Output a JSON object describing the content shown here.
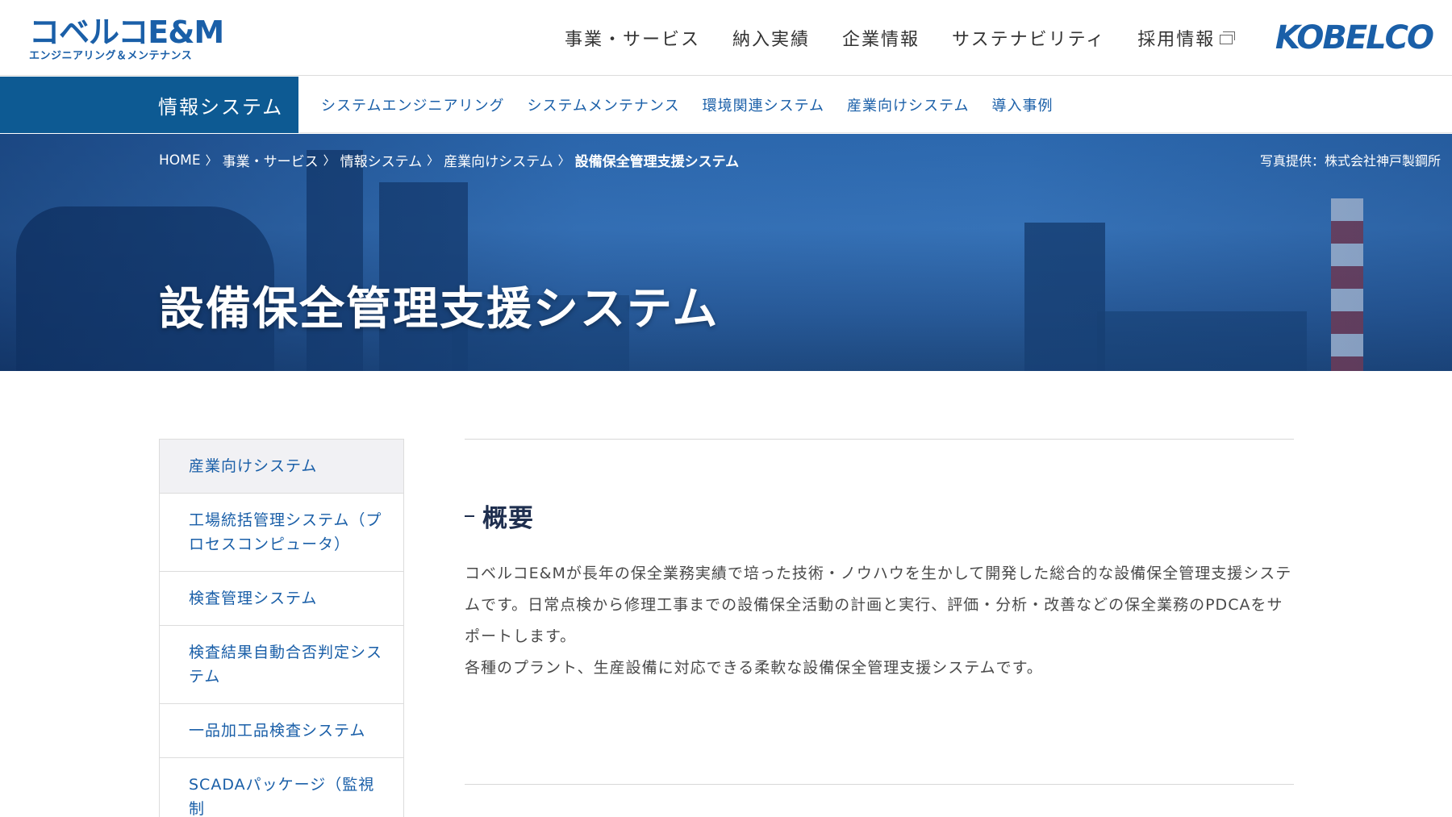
{
  "header": {
    "logo_main": "コベルコE&M",
    "logo_sub": "エンジニアリング＆メンテナンス",
    "nav": [
      {
        "label": "事業・サービス"
      },
      {
        "label": "納入実績"
      },
      {
        "label": "企業情報"
      },
      {
        "label": "サステナビリティ"
      },
      {
        "label": "採用情報",
        "icon": "external-window-icon"
      }
    ],
    "brand": "KOBELCO"
  },
  "subnav": {
    "current": "情報システム",
    "items": [
      {
        "label": "システムエンジニアリング"
      },
      {
        "label": "システムメンテナンス"
      },
      {
        "label": "環境関連システム"
      },
      {
        "label": "産業向けシステム"
      },
      {
        "label": "導入事例"
      }
    ]
  },
  "hero": {
    "breadcrumb": [
      {
        "label": "HOME"
      },
      {
        "label": "事業・サービス"
      },
      {
        "label": "情報システム"
      },
      {
        "label": "産業向けシステム"
      },
      {
        "label": "設備保全管理支援システム"
      }
    ],
    "separator": "〉",
    "photo_credit": "写真提供：株式会社神戸製鋼所",
    "title": "設備保全管理支援システム"
  },
  "sidemenu": {
    "items": [
      {
        "label": "産業向けシステム"
      },
      {
        "label": "工場統括管理システム（プロセスコンピュータ）"
      },
      {
        "label": "検査管理システム"
      },
      {
        "label": "検査結果自動合否判定システム"
      },
      {
        "label": "一品加工品検査システム"
      },
      {
        "label": "SCADAパッケージ（監視制"
      }
    ]
  },
  "content": {
    "section_title": "概要",
    "paragraph_1": "コベルコE&Mが長年の保全業務実績で培った技術・ノウハウを生かして開発した総合的な設備保全管理支援システムです。日常点検から修理工事までの設備保全活動の計画と実行、評価・分析・改善などの保全業務のPDCAをサポートします。",
    "paragraph_2": "各種のプラント、生産設備に対応できる柔軟な設備保全管理支援システムです。"
  },
  "colors": {
    "brand_blue": "#1a5fa8",
    "subnav_active_bg": "#0d5a93",
    "heading": "#1f2f4f"
  }
}
